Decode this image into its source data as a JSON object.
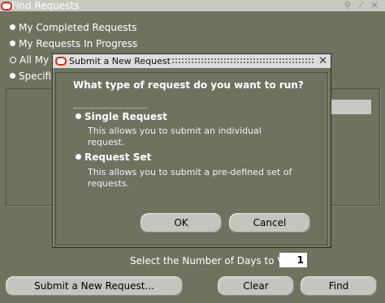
{
  "window": {
    "title": "Find Requests",
    "controls": "⚲ ⁄ ✕"
  },
  "radios": [
    {
      "label": "My Completed Requests",
      "selected": true
    },
    {
      "label": "My Requests In Progress",
      "selected": true
    },
    {
      "label": "All My Requests",
      "label_visible": "All My R",
      "selected": false
    },
    {
      "label": "Specific Requests",
      "label_visible": "Specific",
      "selected": true
    }
  ],
  "days_label": "Select the Number of Days to View:",
  "days_value": "1",
  "buttons": {
    "submit_new": "Submit a New Request...",
    "clear": "Clear",
    "find": "Find"
  },
  "modal": {
    "title": "Submit a New Request",
    "close": "✕",
    "question": "What type of request do you want to run?",
    "options": [
      {
        "label": "Single Request",
        "description": "This allows you to submit an individual request.",
        "selected": true
      },
      {
        "label": "Request Set",
        "description": "This allows you to submit a pre-defined set of requests.",
        "selected": false
      }
    ],
    "ok": "OK",
    "cancel": "Cancel"
  },
  "colors": {
    "background": "#6e7360",
    "button": "#c4c5bf",
    "oracle_red": "#e0261b"
  }
}
